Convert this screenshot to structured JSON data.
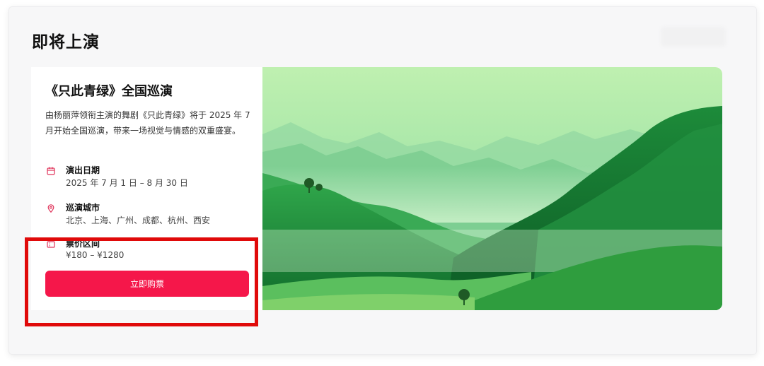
{
  "page": {
    "title": "即将上演"
  },
  "event": {
    "title": "《只此青绿》全国巡演",
    "description": "由杨丽萍领衔主演的舞剧《只此青绿》将于 2025 年 7 月开始全国巡演，带来一场视觉与情感的双重盛宴。",
    "details": [
      {
        "icon": "calendar-icon",
        "label": "演出日期",
        "value": "2025 年 7 月 1 日 – 8 月 30 日"
      },
      {
        "icon": "location-pin-icon",
        "label": "巡演城市",
        "value": "北京、上海、广州、成都、杭州、西安"
      },
      {
        "icon": "ticket-icon",
        "label": "票价区间",
        "value": "¥180 – ¥1280"
      }
    ],
    "buy_label": "立即购票",
    "image_icon": "green-mountain-landscape"
  },
  "colors": {
    "accent": "#f5174a",
    "highlight_box": "#e00a0a",
    "icon": "#e0335a"
  }
}
